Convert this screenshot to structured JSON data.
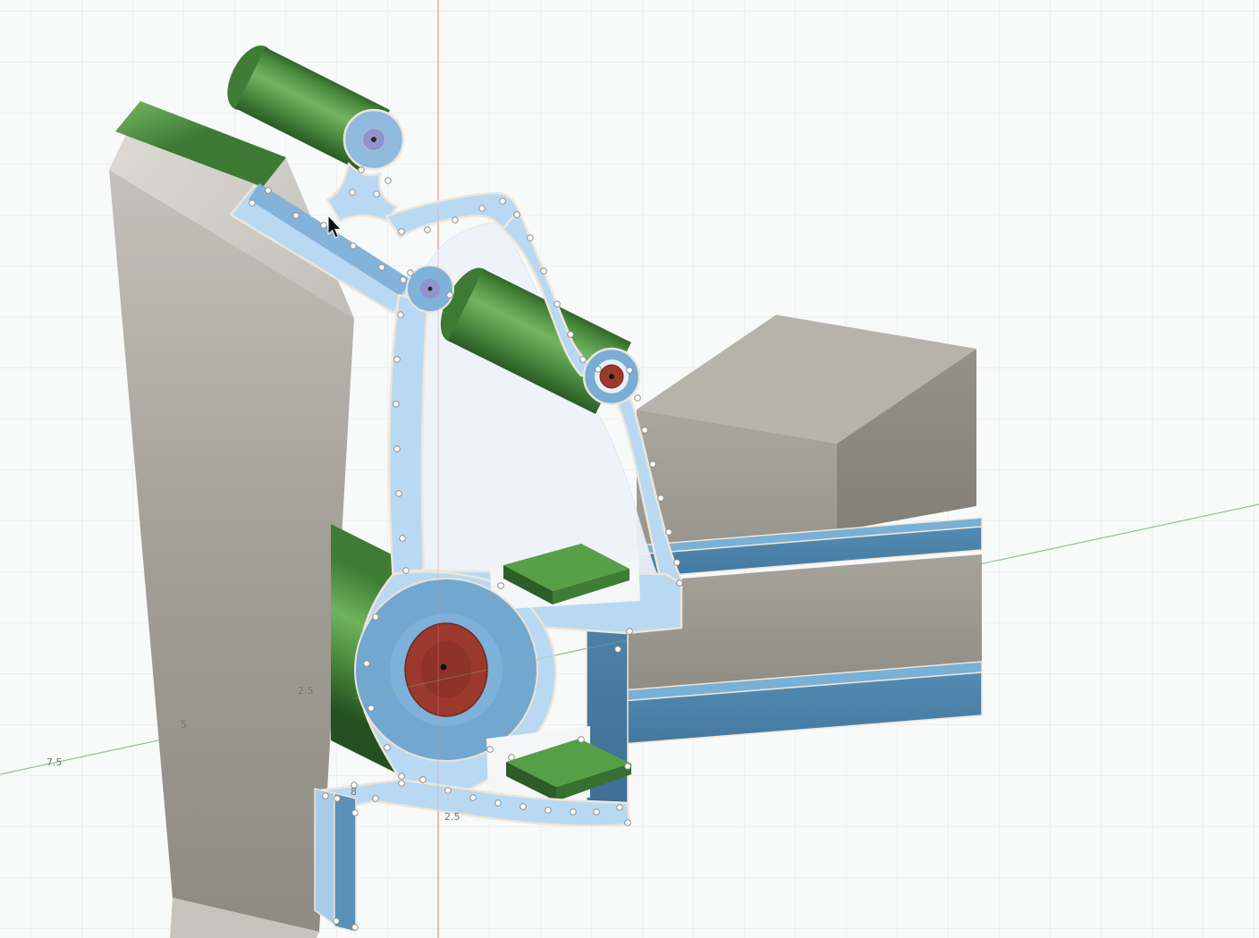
{
  "viewport": {
    "type": "cad-3d-viewport",
    "background": "#f8f9f9",
    "grid_color": "#e4e6e7",
    "axis": {
      "vertical_axis_color": "#e08885",
      "horizontal_axis_color": "#84bf84"
    },
    "dimension_labels": [
      {
        "text": "7.5"
      },
      {
        "text": "5"
      },
      {
        "text": "2.5"
      },
      {
        "text": "8"
      },
      {
        "text": "2.5"
      }
    ],
    "materials": {
      "section_fill": "#b9d8f2",
      "section_edge": "#ece6da",
      "body_gray": "#a5a29a",
      "body_green": "#4f9444",
      "body_blue": "#6fa7d0",
      "hole_red": "#9c392d",
      "hub_lavender": "#9094ce"
    }
  }
}
